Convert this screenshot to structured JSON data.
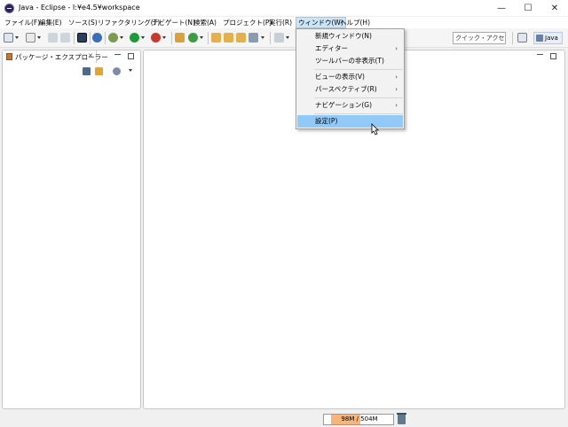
{
  "window": {
    "title": "Java - Eclipse - I:¥e4.5¥workspace",
    "minimize": "—",
    "maximize": "☐",
    "close": "✕"
  },
  "menubar": {
    "items": [
      {
        "label": "ファイル(F)"
      },
      {
        "label": "編集(E)"
      },
      {
        "label": "ソース(S)"
      },
      {
        "label": "リファクタリング(T)"
      },
      {
        "label": "ナビゲート(N)"
      },
      {
        "label": "検索(A)"
      },
      {
        "label": "プロジェクト(P)"
      },
      {
        "label": "実行(R)"
      },
      {
        "label": "ウィンドウ(W)"
      },
      {
        "label": "ヘルプ(H)"
      }
    ],
    "active_index": 8
  },
  "toolbar": {
    "quick_access": "クイック・アクセス",
    "perspective": "Java"
  },
  "package_explorer": {
    "tab_label": "パッケージ・エクスプローラー",
    "tab_close": "✕"
  },
  "window_menu": {
    "items": [
      {
        "label": "新規ウィンドウ(N)",
        "submenu": false
      },
      {
        "label": "エディター",
        "submenu": true
      },
      {
        "label": "ツールバーの非表示(T)",
        "submenu": false
      },
      {
        "label": "ビューの表示(V)",
        "submenu": true
      },
      {
        "label": "パースペクティブ(R)",
        "submenu": true
      },
      {
        "label": "ナビゲーション(G)",
        "submenu": true
      },
      {
        "label": "設定(P)",
        "submenu": false
      }
    ],
    "submenu_arrow": "›",
    "selected_index": 6
  },
  "statusbar": {
    "heap": "98M / 504M",
    "heap_used_fraction": 0.19
  },
  "colors": {
    "accent_selected": "#91c9f7",
    "menu_active": "#cce4f7",
    "heap_fill": "#f8b57a"
  }
}
